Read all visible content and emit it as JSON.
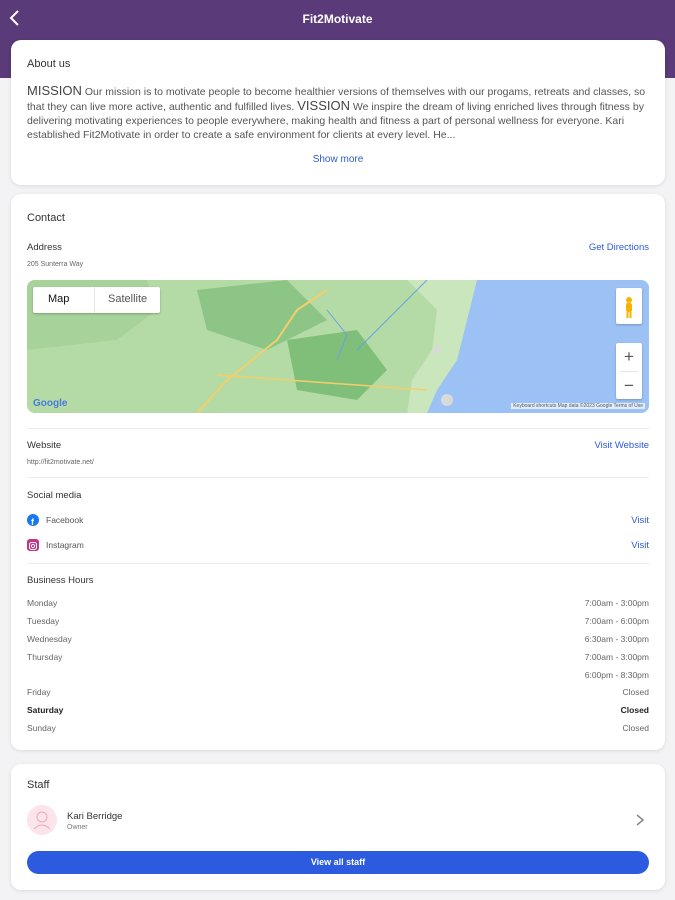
{
  "header": {
    "title": "Fit2Motivate",
    "back_icon": "chevron-left-icon"
  },
  "about": {
    "title": "About us",
    "mission_word": "MISSION",
    "mission_text": " Our mission is to motivate people to become healthier versions of themselves with our progams, retreats and classes, so that they can live more active, authentic and fulfilled lives. ",
    "vision_word": "VISSION",
    "vision_text": " We inspire the dream of living enriched lives through fitness by delivering motivating experiences to people everywhere, making health and fitness a part of personal wellness for everyone.   Kari established Fit2Motivate in order to create a safe environment for clients at every level.  He...",
    "show_more": "Show more"
  },
  "contact": {
    "title": "Contact",
    "address_label": "Address",
    "address_value": "205 Sunterra Way",
    "directions_link": "Get Directions",
    "map": {
      "tab_map": "Map",
      "tab_satellite": "Satellite",
      "google": "Google",
      "attribution": "Keyboard shortcuts   Map data ©2023 Google   Terms of Use",
      "zoom_in": "+",
      "zoom_out": "−"
    },
    "website_label": "Website",
    "website_value": "http://fit2motivate.net/",
    "website_link": "Visit Website",
    "social_label": "Social media",
    "social": [
      {
        "name": "Facebook",
        "link": "Visit",
        "icon": "facebook-icon",
        "color": "#1877f2"
      },
      {
        "name": "Instagram",
        "link": "Visit",
        "icon": "instagram-icon",
        "color": "#c13584"
      }
    ],
    "hours_label": "Business Hours",
    "hours": [
      {
        "day": "Monday",
        "time": "7:00am - 3:00pm"
      },
      {
        "day": "Tuesday",
        "time": "7:00am - 6:00pm"
      },
      {
        "day": "Wednesday",
        "time": "6:30am - 3:00pm"
      },
      {
        "day": "Thursday",
        "time": "7:00am - 3:00pm"
      },
      {
        "day": "",
        "time": "6:00pm - 8:30pm"
      },
      {
        "day": "Friday",
        "time": "Closed"
      },
      {
        "day": "Saturday",
        "time": "Closed"
      },
      {
        "day": "Sunday",
        "time": "Closed"
      }
    ]
  },
  "staff": {
    "title": "Staff",
    "member_name": "Kari Berridge",
    "member_role": "Owner",
    "view_all": "View all staff"
  },
  "colors": {
    "header": "#5a3a78",
    "accent": "#2e5bd6",
    "button": "#2d5be0"
  }
}
